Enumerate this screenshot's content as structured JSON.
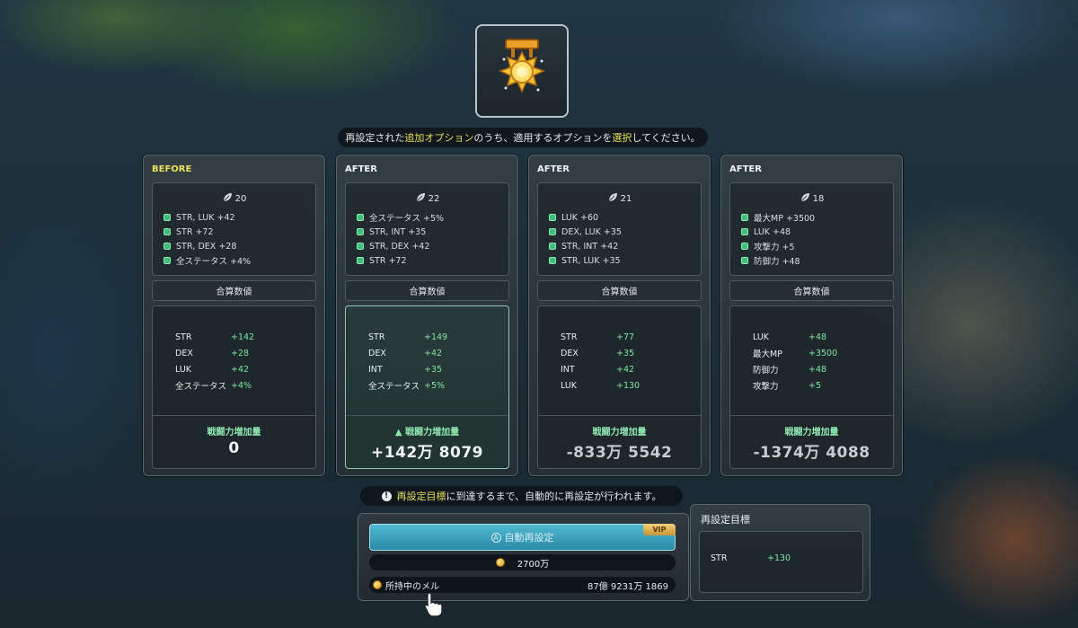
{
  "instruction": {
    "part1": "再設定された",
    "part2": "追加オプション",
    "part3": "のうち、適用するオプションを",
    "part4": "選択",
    "part5": "してください。"
  },
  "colors": {
    "highlight": "#e6e05a",
    "positive": "#7fe6a6",
    "button": "#3aa2bf"
  },
  "columns": [
    {
      "title": "BEFORE",
      "level": "20",
      "options": [
        "STR, LUK +42",
        "STR +72",
        "STR, DEX +28",
        "全ステータス +4%"
      ],
      "summary_label": "合算数値",
      "stats": [
        {
          "k": "STR",
          "v": "+142"
        },
        {
          "k": "DEX",
          "v": "+28"
        },
        {
          "k": "LUK",
          "v": "+42"
        },
        {
          "k": "全ステータス",
          "v": "+4%"
        }
      ],
      "cp_label": "戦闘力増加量",
      "cp_value": "0"
    },
    {
      "title": "AFTER",
      "level": "22",
      "options": [
        "全ステータス +5%",
        "STR, INT +35",
        "STR, DEX +42",
        "STR +72"
      ],
      "summary_label": "合算数値",
      "stats": [
        {
          "k": "STR",
          "v": "+149"
        },
        {
          "k": "DEX",
          "v": "+42"
        },
        {
          "k": "INT",
          "v": "+35"
        },
        {
          "k": "全ステータス",
          "v": "+5%"
        }
      ],
      "cp_label": "▲ 戦闘力増加量",
      "cp_value": "+142万 8079"
    },
    {
      "title": "AFTER",
      "level": "21",
      "options": [
        "LUK +60",
        "DEX, LUK +35",
        "STR, INT +42",
        "STR, LUK +35"
      ],
      "summary_label": "合算数値",
      "stats": [
        {
          "k": "STR",
          "v": "+77"
        },
        {
          "k": "DEX",
          "v": "+35"
        },
        {
          "k": "INT",
          "v": "+42"
        },
        {
          "k": "LUK",
          "v": "+130"
        }
      ],
      "cp_label": "戦闘力増加量",
      "cp_value": "-833万 5542"
    },
    {
      "title": "AFTER",
      "level": "18",
      "options": [
        "最大MP +3500",
        "LUK +48",
        "攻撃力 +5",
        "防御力 +48"
      ],
      "summary_label": "合算数値",
      "stats": [
        {
          "k": "LUK",
          "v": "+48"
        },
        {
          "k": "最大MP",
          "v": "+3500"
        },
        {
          "k": "防御力",
          "v": "+48"
        },
        {
          "k": "攻撃力",
          "v": "+5"
        }
      ],
      "cp_label": "戦闘力増加量",
      "cp_value": "-1374万 4088"
    }
  ],
  "notice": {
    "icon": "warning-icon",
    "part1": "再設定目標",
    "part2": "に到達するまで、自動的に再設定が行われます。"
  },
  "auto_reset": {
    "button_label": "自動再設定",
    "vip_badge": "VIP",
    "cost": "2700万",
    "meso_label": "所持中のメル",
    "meso_amount": "87億 9231万 1869"
  },
  "target": {
    "title": "再設定目標",
    "stat_key": "STR",
    "stat_value": "+130"
  }
}
